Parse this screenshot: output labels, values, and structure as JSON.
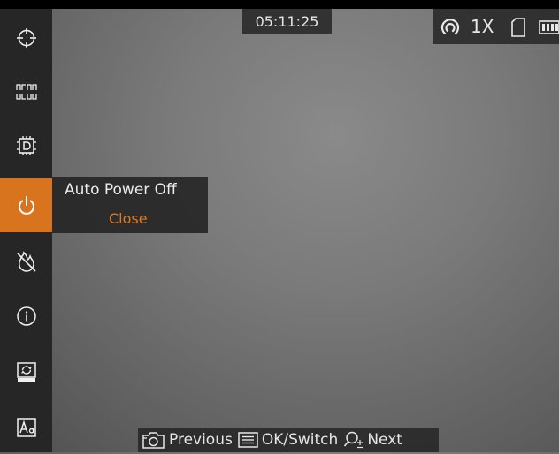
{
  "status": {
    "time": "05:11:25",
    "zoom": "1X",
    "icons": [
      "hotspot-icon",
      "sd-card-icon",
      "battery-icon"
    ]
  },
  "sidebar": {
    "items": [
      {
        "icon": "crosshair-icon",
        "active": false
      },
      {
        "icon": "hotspot-tracking-icon",
        "active": false
      },
      {
        "icon": "picture-in-picture-icon",
        "active": false
      },
      {
        "icon": "power-icon",
        "active": true
      },
      {
        "icon": "hotspot-off-icon",
        "active": false
      },
      {
        "icon": "info-icon",
        "active": false
      },
      {
        "icon": "image-sync-icon",
        "active": false
      },
      {
        "icon": "text-size-icon",
        "active": false
      }
    ],
    "accent_color": "#d9741e"
  },
  "popup": {
    "title": "Auto Power Off",
    "value": "Close",
    "value_color": "#e07a24"
  },
  "hints": {
    "previous": "Previous",
    "ok_switch": "OK/Switch",
    "next": "Next"
  }
}
